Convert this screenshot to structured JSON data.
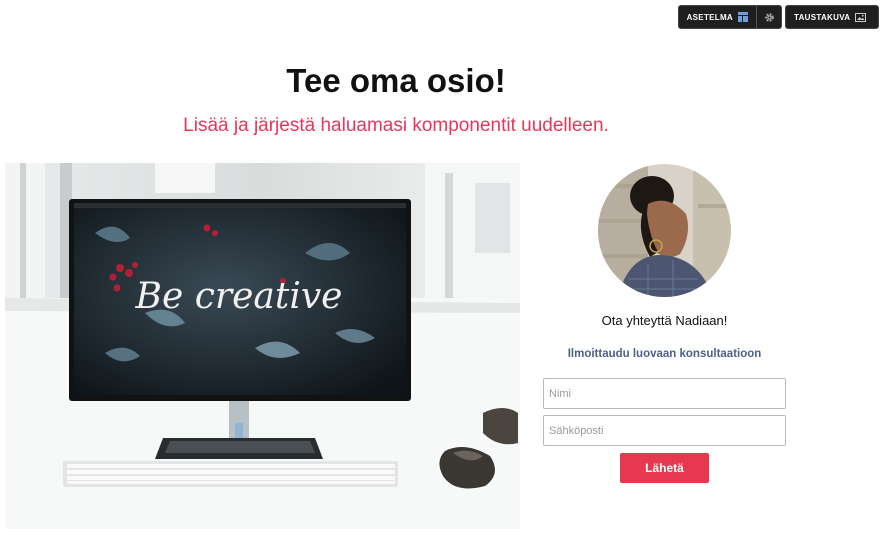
{
  "toolbar": {
    "layout_label": "ASETELMA",
    "layout_icon": "layout-icon",
    "settings_icon": "gear-icon",
    "background_label": "TAUSTAKUVA",
    "background_icon": "image-icon"
  },
  "section": {
    "title": "Tee oma osio!",
    "subtitle": "Lisää ja järjestä haluamasi komponentit uudelleen."
  },
  "hero": {
    "screen_text": "Be creative"
  },
  "contact": {
    "greeting": "Ota yhteyttä Nadiaan!",
    "link_text": "Ilmoittaudu luovaan konsultaatioon",
    "name_placeholder": "Nimi",
    "email_placeholder": "Sähköposti",
    "submit_label": "Lähetä"
  },
  "colors": {
    "accent": "#e6375a",
    "button": "#e6384f",
    "link": "#4e5f86",
    "toolbar_bg": "#1f1f1f"
  }
}
